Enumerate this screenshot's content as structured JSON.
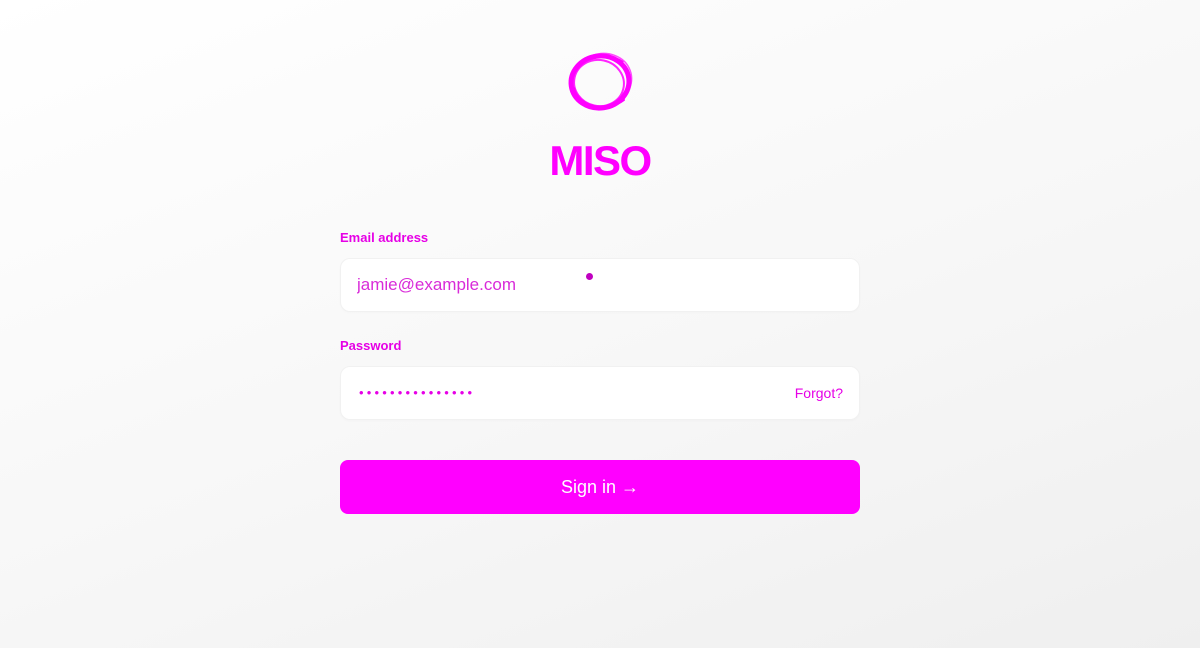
{
  "brand": {
    "name": "MISO",
    "logo_icon": "brush-circle-icon",
    "accent_color": "#ff00ff"
  },
  "form": {
    "email": {
      "label": "Email address",
      "value": "jamie@example.com",
      "placeholder": "jamie@example.com"
    },
    "password": {
      "label": "Password",
      "masked_value": "•••••••••••••••",
      "forgot_label": "Forgot?"
    },
    "submit_label": "Sign in →"
  }
}
